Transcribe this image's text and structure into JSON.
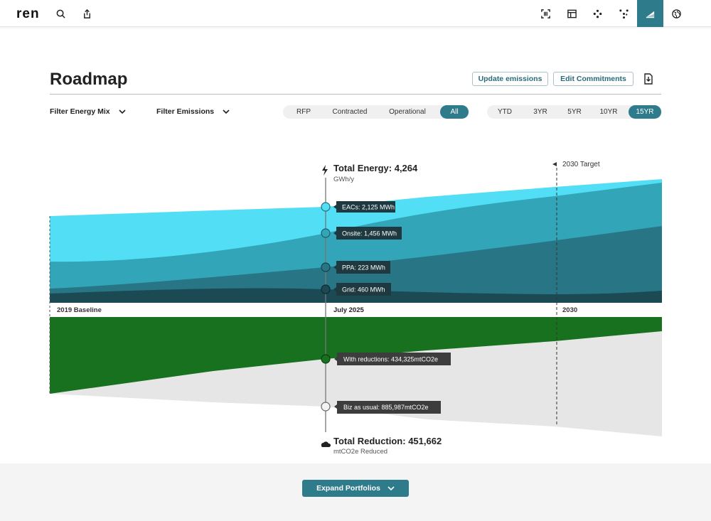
{
  "app": {
    "logo": "ren"
  },
  "topbar": {
    "icons": [
      "search-icon",
      "share-icon",
      "scan-icon",
      "layout-icon",
      "nodes-icon",
      "network-icon",
      "roadmap-icon",
      "globe-icon"
    ],
    "active_icon": "roadmap-icon",
    "accent": "#2e7b8c"
  },
  "header": {
    "title": "Roadmap",
    "update_emissions": "Update  emissions",
    "edit_commitments": "Edit Commitments"
  },
  "filters": {
    "energy_mix": "Filter Energy Mix",
    "emissions": "Filter Emissions",
    "status_options": [
      "RFP",
      "Contracted",
      "Operational",
      "All"
    ],
    "status_selected": "All",
    "range_options": [
      "YTD",
      "3YR",
      "5YR",
      "10YR",
      "15YR"
    ],
    "range_selected": "15YR"
  },
  "chart_data": {
    "type": "area",
    "x_labels": [
      "2019 Baseline",
      "July 2025",
      "2030"
    ],
    "target_label": "2030 Target",
    "energy": {
      "title": "Total Energy: 4,264",
      "unit": "GWh/y",
      "series": [
        {
          "name": "EACs",
          "tooltip": "EACs: 2,125 MWh",
          "color": "#52dff5"
        },
        {
          "name": "Onsite",
          "tooltip": "Onsite: 1,456 MWh",
          "color": "#32a6b8"
        },
        {
          "name": "PPA",
          "tooltip": "PPA: 223 MWh",
          "color": "#287685"
        },
        {
          "name": "Grid",
          "tooltip": "Grid: 460 MWh",
          "color": "#1b4a55"
        }
      ]
    },
    "emissions": {
      "title": "Total Reduction: 451,662",
      "unit": "mtCO2e Reduced",
      "series": [
        {
          "name": "With reductions",
          "tooltip": "With reductions: 434,325mtCO2e",
          "color": "#17711f"
        },
        {
          "name": "Biz as usual",
          "tooltip": "Biz as usual: 885,987mtCO2e",
          "color": "#e6e6e6"
        }
      ]
    }
  },
  "footer": {
    "expand_portfolios": "Expand Portfolios"
  }
}
